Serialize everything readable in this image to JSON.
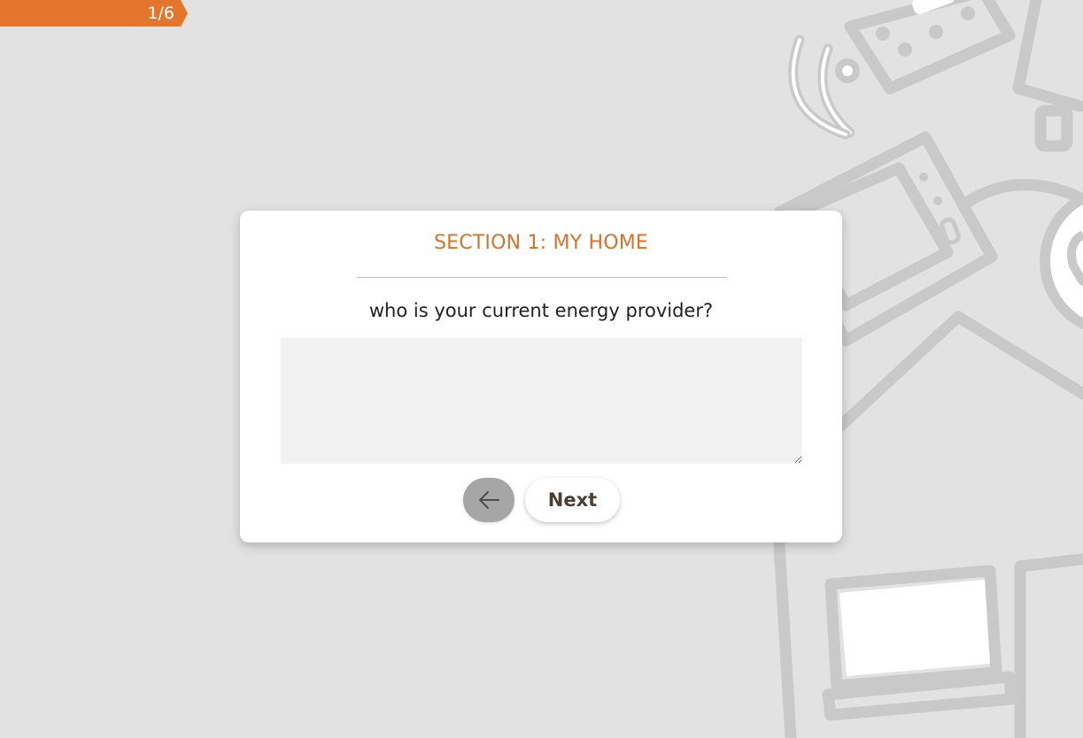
{
  "progress": {
    "label": "1/6",
    "accent_color": "#e3762c"
  },
  "card": {
    "section_title": "SECTION 1: MY HOME",
    "question": "who is your current energy provider?",
    "answer_value": "",
    "back_icon": "arrow-left-icon",
    "next_label": "Next"
  },
  "background": {
    "icons": [
      "wifi-icon",
      "remote-control-icon",
      "phone-charger-icon",
      "microwave-icon",
      "house-roof-icon",
      "laptop-icon",
      "device-screen-icon"
    ],
    "line_color": "#c8c8c8"
  }
}
